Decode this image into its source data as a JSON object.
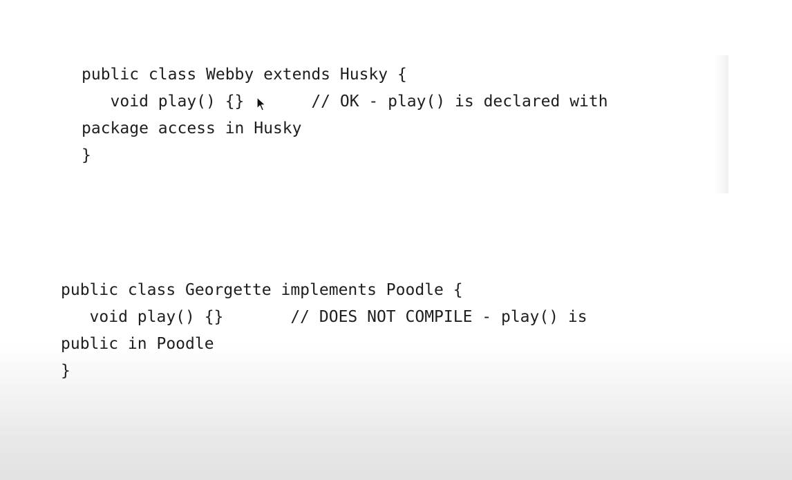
{
  "snippet_1": {
    "lines": [
      "public class Webby extends Husky {",
      "   void play() {}       // OK - play() is declared with",
      "package access in Husky",
      "}"
    ]
  },
  "snippet_2": {
    "lines": [
      "public class Georgette implements Poodle {",
      "   void play() {}       // DOES NOT COMPILE - play() is",
      "public in Poodle",
      "}"
    ]
  }
}
